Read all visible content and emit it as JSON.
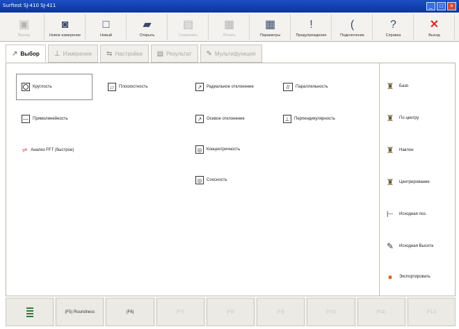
{
  "window": {
    "title": "Surftest SJ-410 SJ-411",
    "buttons": [
      "_",
      "□",
      "×"
    ]
  },
  "toolbar": {
    "buttons": [
      {
        "label": "Выход",
        "icon": "door-icon",
        "glyph": "▣",
        "enabled": false
      },
      {
        "label": "Новое измерение",
        "icon": "instrument-icon",
        "glyph": "◙",
        "enabled": true
      },
      {
        "label": "Новый",
        "icon": "new-doc-icon",
        "glyph": "□",
        "enabled": true
      },
      {
        "label": "Открыть",
        "icon": "open-folder-icon",
        "glyph": "▰",
        "enabled": true
      },
      {
        "label": "Сохранить",
        "icon": "save-icon",
        "glyph": "▤",
        "enabled": false
      },
      {
        "label": "Печать",
        "icon": "print-icon",
        "glyph": "▦",
        "enabled": false
      },
      {
        "label": "Параметры",
        "icon": "parameters-icon",
        "glyph": "▦",
        "enabled": true
      },
      {
        "label": "Предупреждение",
        "icon": "warning-icon",
        "glyph": "!",
        "enabled": true
      },
      {
        "label": "Подключение",
        "icon": "connect-icon",
        "glyph": "(",
        "enabled": true
      },
      {
        "label": "Справка",
        "icon": "help-icon",
        "glyph": "?",
        "enabled": true
      },
      {
        "label": "Выход",
        "icon": "exit-icon",
        "glyph": "✕",
        "enabled": true
      }
    ]
  },
  "tabs": [
    {
      "label": "Выбор",
      "icon": "pointer-icon",
      "glyph": "↗",
      "active": true
    },
    {
      "label": "Измерение",
      "icon": "measure-icon",
      "glyph": "⊥",
      "active": false
    },
    {
      "label": "Настройки",
      "icon": "settings-icon",
      "glyph": "⇆",
      "active": false
    },
    {
      "label": "Результат",
      "icon": "result-icon",
      "glyph": "▤",
      "active": false
    },
    {
      "label": "Мультифункция",
      "icon": "multifunction-icon",
      "glyph": "✎",
      "active": false
    }
  ],
  "measurements": [
    {
      "label": "Круглость",
      "icon": "circle-icon",
      "glyph": "",
      "shape": "circ"
    },
    {
      "label": "Плоскостность",
      "icon": "flatness-icon",
      "glyph": "▱",
      "shape": "box"
    },
    {
      "label": "Радиальное отклонение",
      "icon": "radial-runout-icon",
      "glyph": "↗",
      "shape": "box"
    },
    {
      "label": "Параллельность",
      "icon": "parallelism-icon",
      "glyph": "//",
      "shape": "dbl"
    },
    {
      "label": "Прямолинейность",
      "icon": "straightness-icon",
      "glyph": "—",
      "shape": "box"
    },
    {
      "label": "Осевое отклонение",
      "icon": "axial-runout-icon",
      "glyph": "↗",
      "shape": "box"
    },
    {
      "label": "Перпендикулярность",
      "icon": "perpendicularity-icon",
      "glyph": "⊥",
      "shape": "box"
    },
    {
      "label": "Анализ FFT (быстрое)",
      "icon": "fft-icon",
      "glyph": "⩫",
      "shape": "none"
    },
    {
      "label": "Концентричность",
      "icon": "concentricity-icon",
      "glyph": "◎",
      "shape": "box"
    },
    {
      "label": "Соосность",
      "icon": "coaxiality-icon",
      "glyph": "◎",
      "shape": "box"
    }
  ],
  "right_panel": [
    {
      "label": "Базо",
      "icon": "base-icon",
      "glyph": "♜"
    },
    {
      "label": "По центру",
      "icon": "center-icon",
      "glyph": "♜"
    },
    {
      "label": "Наклон",
      "icon": "tilt-icon",
      "glyph": "♜"
    },
    {
      "label": "Центрирование",
      "icon": "centering-icon",
      "glyph": "♜"
    },
    {
      "label": "Исходная поз.",
      "icon": "home-position-icon",
      "glyph": "⊢"
    },
    {
      "label": "Исходная Высота",
      "icon": "home-height-icon",
      "glyph": "✎"
    },
    {
      "label": "Экспортировать",
      "icon": "export-icon",
      "glyph": "●"
    }
  ],
  "bottom_buttons": [
    {
      "label": "",
      "icon": "list-icon",
      "enabled": true
    },
    {
      "label": "(F5) Roundness",
      "enabled": true
    },
    {
      "label": "(F6)",
      "enabled": true
    },
    {
      "label": "(F7)",
      "enabled": false
    },
    {
      "label": "(F8)",
      "enabled": false
    },
    {
      "label": "(F9)",
      "enabled": false
    },
    {
      "label": "(F10)",
      "enabled": false
    },
    {
      "label": "(F11)",
      "enabled": false
    },
    {
      "label": "(F12)",
      "enabled": false
    }
  ]
}
